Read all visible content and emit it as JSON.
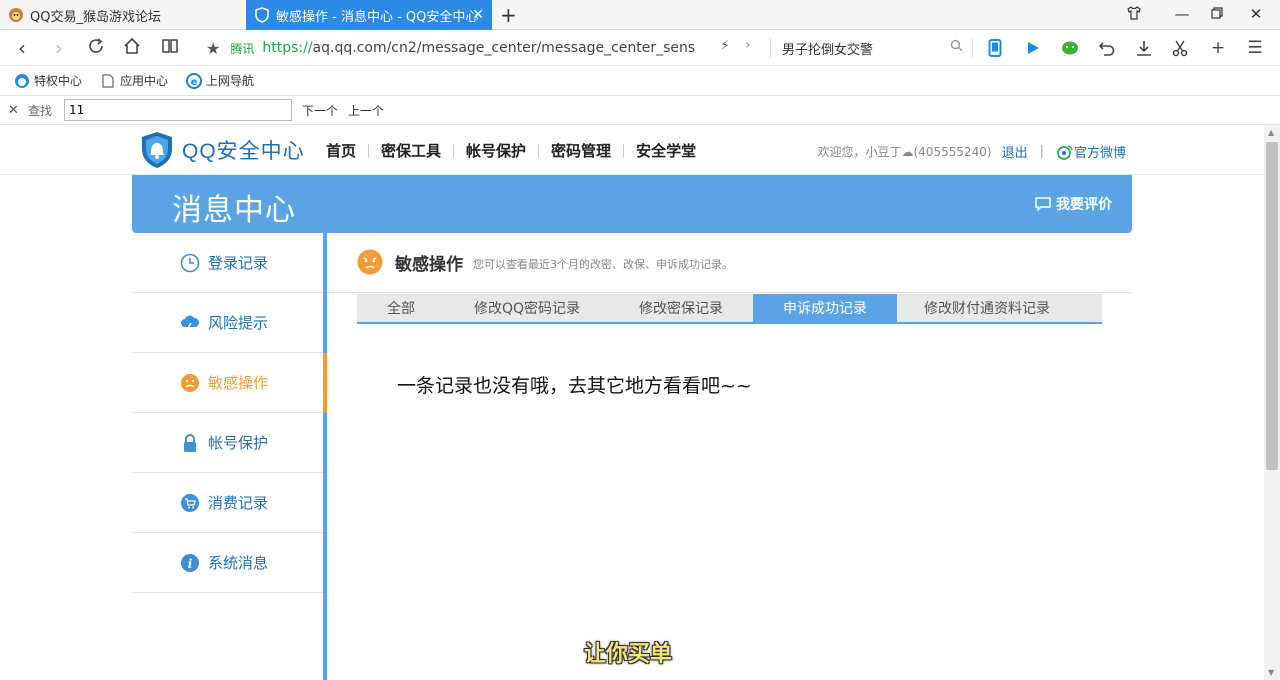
{
  "browser": {
    "tabs": [
      {
        "title": "QQ交易_猴岛游戏论坛"
      },
      {
        "title": "敏感操作 - 消息中心 - QQ安全中心"
      }
    ],
    "address": {
      "site_label": "腾讯",
      "url_scheme": "https://",
      "url_rest": "aq.qq.com/cn2/message_center/message_center_sens"
    },
    "search_text": "男子抡倒女交警",
    "bookmarks": [
      {
        "label": "特权中心"
      },
      {
        "label": "应用中心"
      },
      {
        "label": "上网导航"
      }
    ],
    "find": {
      "label": "查找",
      "value": "11",
      "next": "下一个",
      "prev": "上一个"
    }
  },
  "header": {
    "brand": "QQ安全中心",
    "nav": [
      "首页",
      "密保工具",
      "帐号保护",
      "密码管理",
      "安全学堂"
    ],
    "welcome": "欢迎您，小豆丁☁(405555240)",
    "logout": "退出",
    "weibo": "官方微博"
  },
  "banner": {
    "title": "消息中心",
    "rate": "我要评价"
  },
  "sidebar": {
    "items": [
      {
        "label": "登录记录",
        "icon": "clock-icon"
      },
      {
        "label": "风险提示",
        "icon": "cloud-lightning-icon"
      },
      {
        "label": "敏感操作",
        "icon": "face-icon"
      },
      {
        "label": "帐号保护",
        "icon": "lock-icon"
      },
      {
        "label": "消费记录",
        "icon": "cart-icon"
      },
      {
        "label": "系统消息",
        "icon": "info-icon"
      }
    ],
    "active_index": 2
  },
  "main": {
    "title": "敏感操作",
    "desc": "您可以查看最近3个月的改密、改保、申诉成功记录。",
    "tabs": [
      "全部",
      "修改QQ密码记录",
      "修改密保记录",
      "申诉成功记录",
      "修改财付通资料记录"
    ],
    "active_tab": 3,
    "empty_text": "一条记录也没有哦，去其它地方看看吧~~"
  },
  "overlay_subtitle": "让你买单",
  "colors": {
    "accent": "#5aa4e6",
    "active": "#f39b34",
    "link": "#1f6fb5",
    "tab_active": "#2b8ae6"
  }
}
